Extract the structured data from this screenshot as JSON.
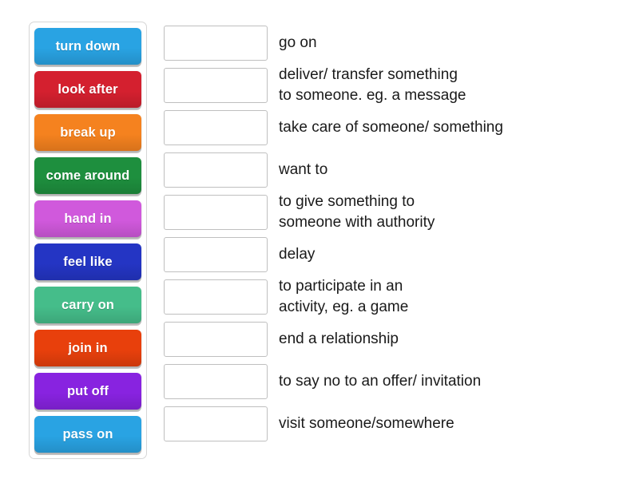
{
  "activity": {
    "type": "drag-and-drop-matching",
    "tray": {
      "tiles": [
        {
          "label": "turn down",
          "color": "#29a3e3"
        },
        {
          "label": "look after",
          "color": "#d4202f"
        },
        {
          "label": "break up",
          "color": "#f5821f"
        },
        {
          "label": "come around",
          "color": "#1e8f3e"
        },
        {
          "label": "hand in",
          "color": "#d059dc"
        },
        {
          "label": "feel like",
          "color": "#2435c4"
        },
        {
          "label": "carry on",
          "color": "#45bd8a"
        },
        {
          "label": "join in",
          "color": "#e8400c"
        },
        {
          "label": "put off",
          "color": "#8823e0"
        },
        {
          "label": "pass on",
          "color": "#29a3e3"
        }
      ]
    },
    "rows": [
      {
        "answer": "",
        "definition": "go on"
      },
      {
        "answer": "",
        "definition": "deliver/ transfer something\nto someone. eg. a message"
      },
      {
        "answer": "",
        "definition": "take care of someone/ something"
      },
      {
        "answer": "",
        "definition": "want to"
      },
      {
        "answer": "",
        "definition": "to give something to\nsomeone with authority"
      },
      {
        "answer": "",
        "definition": "delay"
      },
      {
        "answer": "",
        "definition": "to participate in an\nactivity, eg. a game"
      },
      {
        "answer": "",
        "definition": "end a relationship"
      },
      {
        "answer": "",
        "definition": "to say no to an offer/ invitation"
      },
      {
        "answer": "",
        "definition": "visit someone/somewhere"
      }
    ]
  }
}
